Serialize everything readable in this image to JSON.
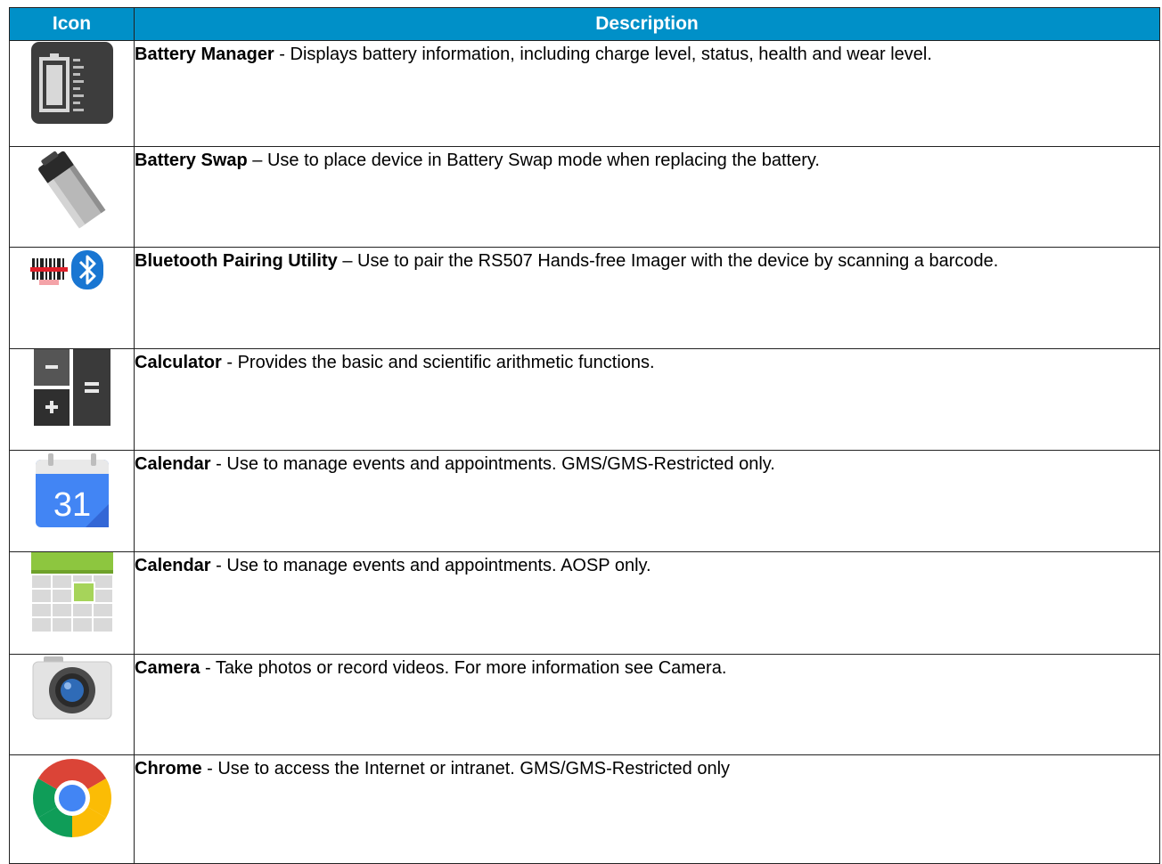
{
  "table": {
    "header": {
      "icon": "Icon",
      "description": "Description"
    },
    "rows": [
      {
        "icon": "battery-manager-icon",
        "name": "Battery Manager",
        "separator": " - ",
        "text": "Displays battery information, including charge level, status, health and wear level."
      },
      {
        "icon": "battery-swap-icon",
        "name": "Battery Swap",
        "separator": " – ",
        "text": "Use to place device in Battery Swap mode when replacing the battery."
      },
      {
        "icon": "bluetooth-pairing-icon",
        "name": "Bluetooth Pairing Utility",
        "separator": " – ",
        "text": "Use to pair the RS507 Hands-free Imager with the device by scanning a barcode."
      },
      {
        "icon": "calculator-icon",
        "name": "Calculator",
        "separator": " - ",
        "text": "Provides the basic and scientific arithmetic functions."
      },
      {
        "icon": "google-calendar-icon",
        "icon_text": "31",
        "name": "Calendar",
        "separator": " - ",
        "text": "Use to manage events and appointments. GMS/GMS-Restricted only."
      },
      {
        "icon": "aosp-calendar-icon",
        "name": "Calendar",
        "separator": " - ",
        "text": "Use to manage events and appointments. AOSP only."
      },
      {
        "icon": "camera-icon",
        "name": "Camera",
        "separator": " - ",
        "text": "Take photos or record videos. For more information see Camera."
      },
      {
        "icon": "chrome-icon",
        "name": "Chrome",
        "separator": " - ",
        "text": "Use to access the Internet or intranet. GMS/GMS-Restricted only"
      }
    ]
  },
  "colors": {
    "header_bg": "#0090c8",
    "header_text": "#ffffff"
  }
}
